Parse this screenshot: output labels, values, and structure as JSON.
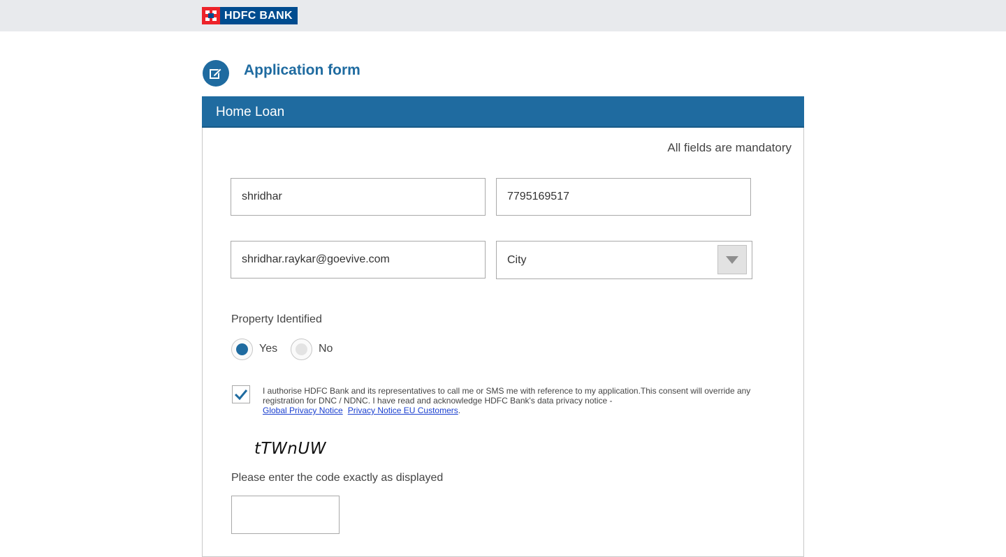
{
  "header": {
    "bank_name": "HDFC BANK",
    "logo_icon": "hdfc-logo-icon",
    "colors": {
      "brand_blue": "#004c8f",
      "brand_red": "#ed232a",
      "accent": "#1f6ba0"
    }
  },
  "form": {
    "title": "Application form",
    "icon": "edit-form-icon",
    "section_title": "Home Loan",
    "mandatory_note": "All fields are mandatory",
    "fields": {
      "name": "shridhar",
      "mobile": "7795169517",
      "email": "shridhar.raykar@goevive.com",
      "city": "City"
    },
    "property": {
      "label": "Property Identified",
      "yes_label": "Yes",
      "no_label": "No",
      "selected": "Yes"
    },
    "consent": {
      "checked": true,
      "text": "I authorise HDFC Bank and its representatives to call me or SMS me with reference to my application.This consent will override any registration for DNC / NDNC. I have read and acknowledge HDFC Bank's data privacy notice -",
      "link1": "Global Privacy Notice",
      "link2": "Privacy Notice EU Customers",
      "end": "."
    },
    "captcha": {
      "code": "tTWnUW",
      "instruction": "Please enter the code exactly as displayed",
      "value": ""
    }
  }
}
